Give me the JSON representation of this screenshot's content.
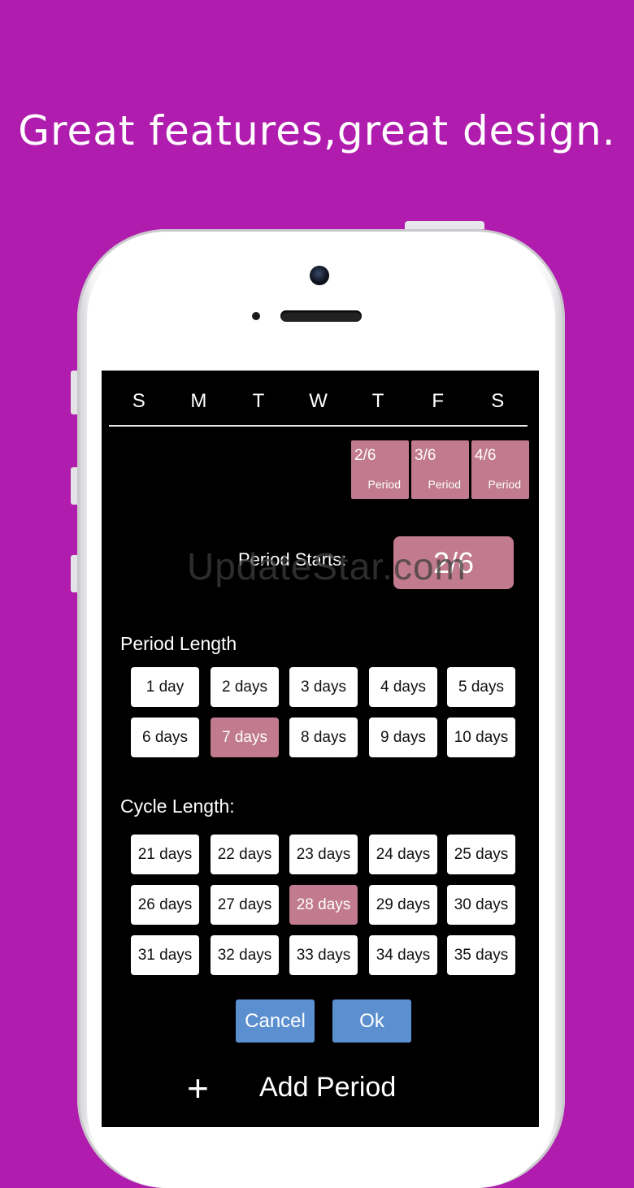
{
  "headline": "Great features,great design.",
  "weekdays": [
    "S",
    "M",
    "T",
    "W",
    "T",
    "F",
    "S"
  ],
  "calendar_cells": [
    {
      "date": "2/6",
      "label": "Period"
    },
    {
      "date": "3/6",
      "label": "Period"
    },
    {
      "date": "4/6",
      "label": "Period"
    }
  ],
  "period_starts": {
    "label": "Period Starts:",
    "value": "2/6"
  },
  "watermark": "UpdateStar.com",
  "period_length": {
    "title": "Period Length",
    "options": [
      "1 day",
      "2 days",
      "3 days",
      "4 days",
      "5 days",
      "6 days",
      "7 days",
      "8 days",
      "9 days",
      "10 days"
    ],
    "selected": "7 days"
  },
  "cycle_length": {
    "title": "Cycle Length:",
    "options": [
      "21 days",
      "22 days",
      "23 days",
      "24 days",
      "25 days",
      "26 days",
      "27 days",
      "28 days",
      "29 days",
      "30 days",
      "31 days",
      "32 days",
      "33 days",
      "34 days",
      "35 days"
    ],
    "selected": "28 days"
  },
  "actions": {
    "cancel": "Cancel",
    "ok": "Ok"
  },
  "add_period": {
    "icon": "+",
    "label": "Add Period"
  },
  "colors": {
    "background": "#b01cae",
    "accent": "#c17a8e",
    "button": "#5b8fd0"
  }
}
